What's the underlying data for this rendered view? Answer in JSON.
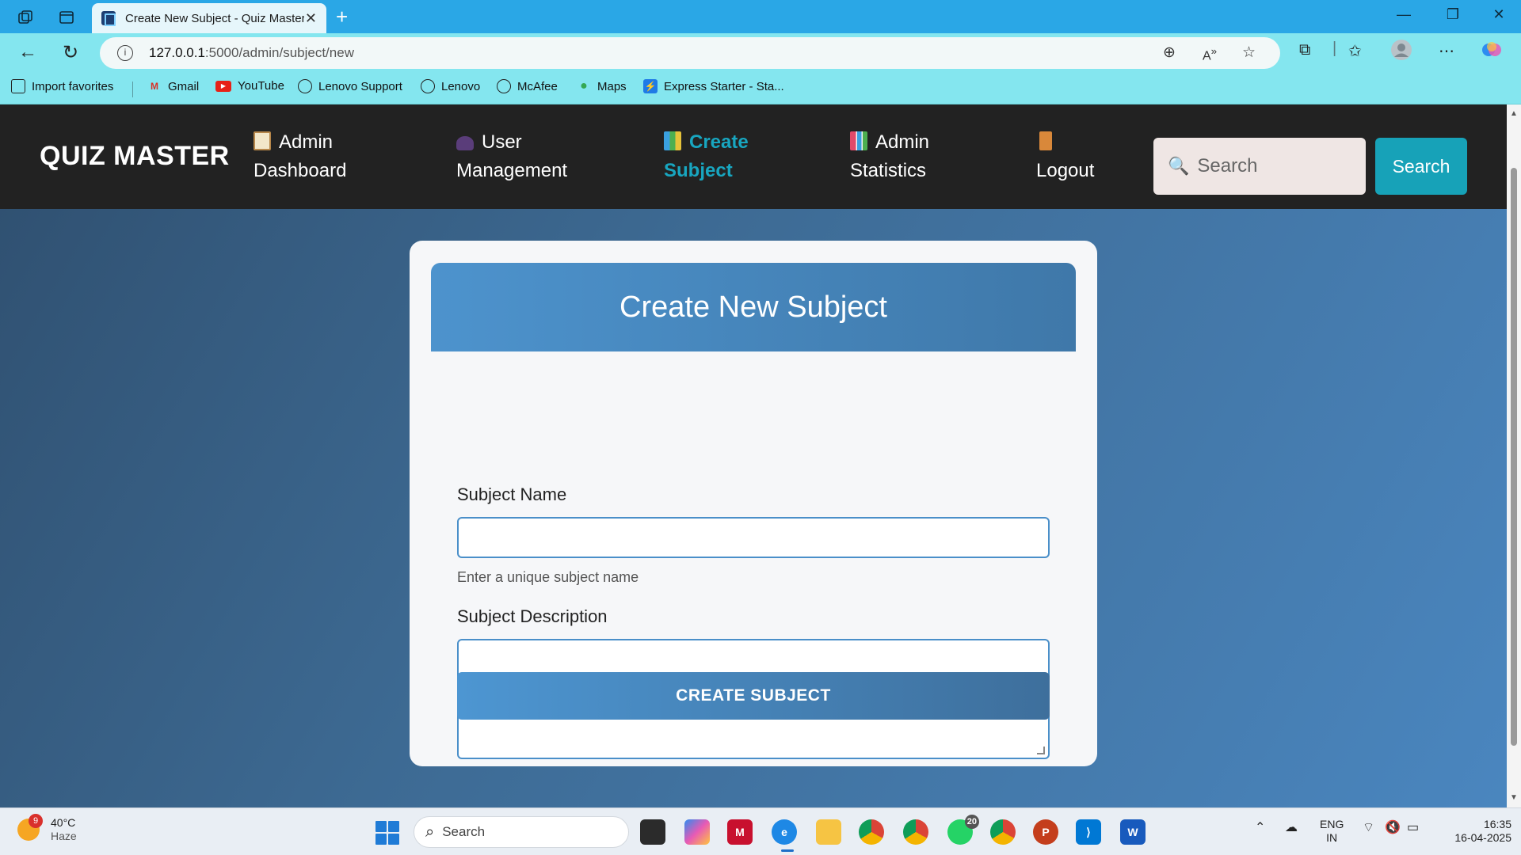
{
  "browser": {
    "tab_title": "Create New Subject - Quiz Master",
    "url_host": "127.0.0.1",
    "url_path": ":5000/admin/subject/new",
    "favorites": [
      {
        "label": "Import favorites",
        "icon": "import-icon"
      },
      {
        "label": "Gmail",
        "icon": "gmail-icon"
      },
      {
        "label": "YouTube",
        "icon": "youtube-icon"
      },
      {
        "label": "Lenovo Support",
        "icon": "globe-icon"
      },
      {
        "label": "Lenovo",
        "icon": "globe-icon"
      },
      {
        "label": "McAfee",
        "icon": "globe-icon"
      },
      {
        "label": "Maps",
        "icon": "maps-pin-icon"
      },
      {
        "label": "Express Starter - Sta...",
        "icon": "lightning-icon"
      }
    ]
  },
  "navbar": {
    "brand": "QUIZ MASTER",
    "links": [
      {
        "line1": "Admin",
        "line2": "Dashboard",
        "icon": "clipboard-icon",
        "active": false
      },
      {
        "line1": "User",
        "line2": "Management",
        "icon": "users-icon",
        "active": false
      },
      {
        "line1": "Create",
        "line2": "Subject",
        "icon": "books-icon",
        "active": true
      },
      {
        "line1": "Admin",
        "line2": "Statistics",
        "icon": "bar-chart-icon",
        "active": false
      },
      {
        "line1": "",
        "line2": "Logout",
        "icon": "door-icon",
        "active": false
      }
    ],
    "search_placeholder": "Search",
    "search_button": "Search"
  },
  "form": {
    "title": "Create New Subject",
    "name_label": "Subject Name",
    "name_value": "",
    "name_hint": "Enter a unique subject name",
    "description_label": "Subject Description",
    "description_value": "",
    "submit_label": "CREATE SUBJECT"
  },
  "taskbar": {
    "weather_badge": "9",
    "weather_temp": "40°C",
    "weather_desc": "Haze",
    "search_placeholder": "Search",
    "whatsapp_badge": "20",
    "lang_line1": "ENG",
    "lang_line2": "IN",
    "time": "16:35",
    "date": "16-04-2025"
  },
  "colors": {
    "titlebar": "#2aa7e6",
    "addressbar": "#84e6ef",
    "navbar_bg": "#222222",
    "nav_active": "#18a6c0",
    "search_button": "#17a2b8",
    "card_header": "#4d93cd"
  }
}
